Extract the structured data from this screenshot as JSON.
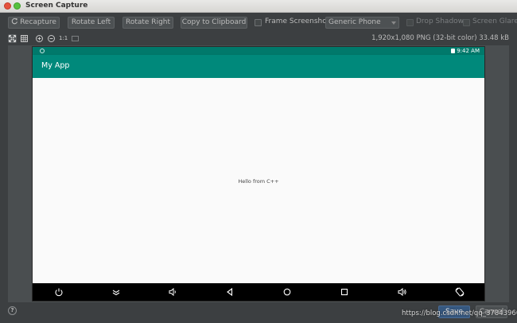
{
  "window": {
    "title": "Screen Capture"
  },
  "toolbar": {
    "recapture_label": "Recapture",
    "rotate_left_label": "Rotate Left",
    "rotate_right_label": "Rotate Right",
    "copy_label": "Copy to Clipboard",
    "frame_label": "Frame Screenshot",
    "frame_checked": false,
    "device_select": "Generic Phone",
    "drop_shadow_label": "Drop Shadow",
    "screen_glare_label": "Screen Glare"
  },
  "subbar": {
    "zoom_label": "1:1",
    "image_info": "1,920x1,080 PNG (32-bit color) 33.48 kB"
  },
  "device": {
    "status_time": "9:42 AM",
    "app_title": "My App",
    "content_text": "Hello from C++",
    "status_bar_color": "#00796b",
    "app_bar_color": "#00897b",
    "nav_icons": [
      "power-icon",
      "expand-down-icon",
      "volume-down-icon",
      "back-icon",
      "home-icon",
      "recents-icon",
      "volume-up-icon",
      "rotate-icon"
    ]
  },
  "footer": {
    "help_label": "?",
    "save_label": "Save",
    "cancel_label": "Cancel",
    "watermark": "https://blog.csdn.net/qq_37843960"
  }
}
